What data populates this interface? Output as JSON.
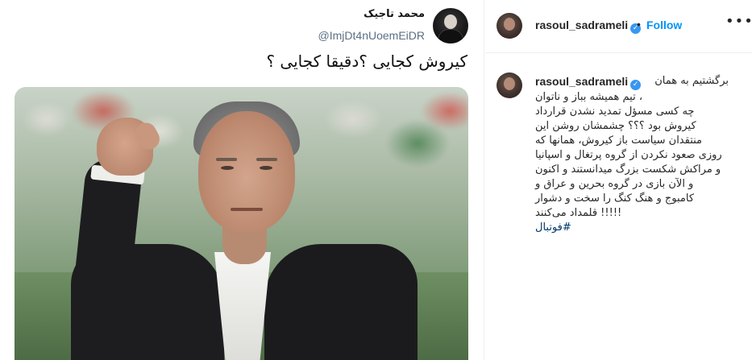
{
  "tweet": {
    "author_name": "محمد تاجیک",
    "handle": "@ImjDt4nUoemEiDR",
    "text": "کیروش کجایی ؟دقیقا کجایی ؟"
  },
  "post": {
    "username": "rasoul_sadrameli",
    "verified_icon": "verified-badge-icon",
    "separator": "•",
    "follow_label": "Follow",
    "more_label": "•••",
    "caption": {
      "username": "rasoul_sadrameli",
      "first_line": "برگشتیم به همان",
      "lines": [
        "، تیم همیشه بباز و ناتوان",
        "چه کسی مسؤل تمدید نشدن قرارداد",
        "کیروش بود ؟؟؟ چشمشان روشن این",
        "منتقدان سیاست باز کیروش، همانها که",
        "روزی صعود نکردن از گروه پرتغال و اسپانیا",
        "و مراکش شکست بزرگ میدانستند و اکنون",
        "و الآن بازی در گروه بحرین و عراق و",
        "کامبوج و هنگ کنگ را سخت و دشوار",
        "!!!!! قلمداد می‌کنند"
      ],
      "hashtag": "#فوتبال"
    }
  },
  "colors": {
    "link_blue": "#0095f6",
    "verified_blue": "#3897f0",
    "hashtag": "#00376b",
    "text": "#262626"
  }
}
